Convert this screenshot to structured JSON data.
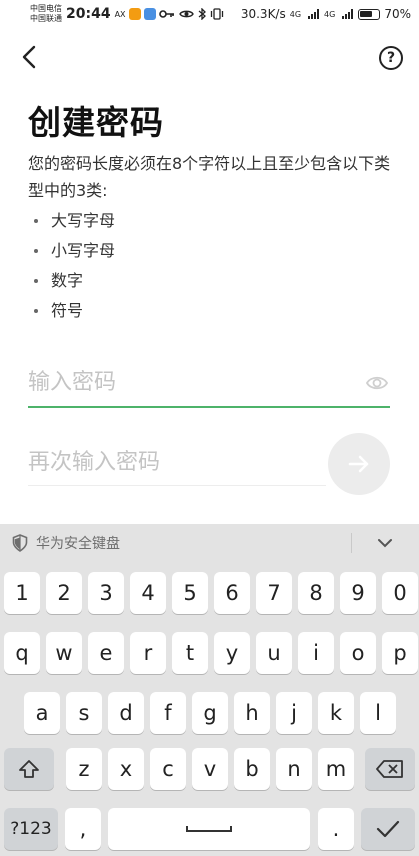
{
  "status": {
    "carrier1": "中国电信",
    "carrier2": "中国联通",
    "time": "20:44",
    "ax": "AX",
    "net_speed": "30.3K/s",
    "signal1": "4G",
    "signal2": "4G",
    "battery": "70%",
    "app_colors": [
      "#f39c12",
      "#4a90e2"
    ]
  },
  "header": {
    "back_icon": "chevron-left-icon",
    "help_icon": "question-circle-icon",
    "help_glyph": "?"
  },
  "page": {
    "title": "创建密码",
    "description": "您的密码长度必须在8个字符以上且至少包含以下类型中的3类:",
    "requirements": [
      "大写字母",
      "小写字母",
      "数字",
      "符号"
    ]
  },
  "form": {
    "password_placeholder": "输入密码",
    "password_value": "",
    "confirm_placeholder": "再次输入密码",
    "confirm_value": "",
    "accent_color": "#4db36a"
  },
  "keyboard": {
    "title": "华为安全键盘",
    "row_numbers": [
      "1",
      "2",
      "3",
      "4",
      "5",
      "6",
      "7",
      "8",
      "9",
      "0"
    ],
    "row_q": [
      "q",
      "w",
      "e",
      "r",
      "t",
      "y",
      "u",
      "i",
      "o",
      "p"
    ],
    "row_a": [
      "a",
      "s",
      "d",
      "f",
      "g",
      "h",
      "j",
      "k",
      "l"
    ],
    "row_z": [
      "z",
      "x",
      "c",
      "v",
      "b",
      "n",
      "m"
    ],
    "symbols_key": "?123",
    "comma_key": ",",
    "period_key": "."
  }
}
